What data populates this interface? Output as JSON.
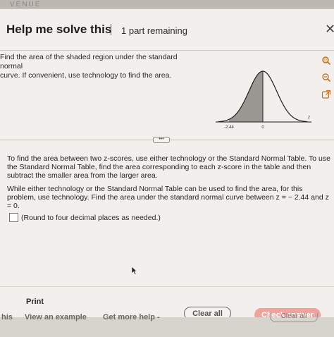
{
  "background_stub": "VENUE",
  "dialog": {
    "title": "Help me solve this",
    "parts_remaining": "1 part remaining",
    "close_glyph": "✕"
  },
  "question": {
    "line1": "Find the area of the shaded region under the standard normal",
    "line2": "curve. If convenient, use technology to find the area."
  },
  "chart_data": {
    "type": "area",
    "title": "",
    "x_ticks": [
      "-2.44",
      "0"
    ],
    "axis_label": "z",
    "shaded_from_z": -2.44,
    "shaded_to_z": 0,
    "xlim": [
      -3.2,
      3.2
    ]
  },
  "tools": [
    "zoom-in-icon",
    "zoom-out-icon",
    "open-external-icon"
  ],
  "help": {
    "paragraph1": "To find the area between two z-scores, use either technology or the Standard Normal Table. To use the Standard Normal Table, find the area corresponding to each z-score in the table and then subtract the smaller area from the larger area.",
    "paragraph2": "While either technology or the Standard Normal Table can be used to find the area, for this problem, use technology. Find the area under the standard normal curve between z = − 2.44 and z = 0.",
    "answer_hint": "(Round to four decimal places as needed.)",
    "answer_value": ""
  },
  "footer": {
    "print": "Print",
    "clear_all": "Clear all",
    "check_answer": "Check answer"
  },
  "behind": {
    "left_stub": "his",
    "view_example": "View an example",
    "get_more_help": "Get more help -",
    "clear_all": "Clear all"
  },
  "colors": {
    "shade": "#9b9893",
    "check_button": "#f1a29a"
  }
}
